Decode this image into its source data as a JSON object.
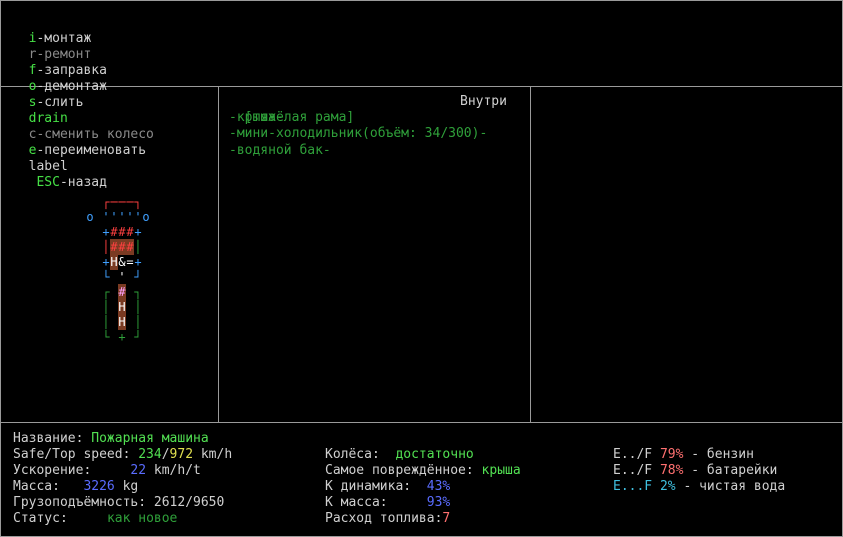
{
  "hotkeys": [
    {
      "key": "i",
      "label": "-монтаж",
      "enabled": true
    },
    {
      "key": "r",
      "label": "-ремонт",
      "enabled": false
    },
    {
      "key": "f",
      "label": "-заправка",
      "enabled": true
    },
    {
      "key": "o",
      "label": "-демонтаж",
      "enabled": true
    },
    {
      "key": "s",
      "label": "-слить",
      "enabled": true
    },
    {
      "key": "drain",
      "label": "",
      "enabled": true
    },
    {
      "key": "c",
      "label": "-сменить колесо",
      "enabled": false
    },
    {
      "key": "e",
      "label": "-переименовать",
      "enabled": true
    },
    {
      "key": "label",
      "label": "",
      "enabled": true
    },
    {
      "key": "ESC",
      "label": "-назад",
      "enabled": true
    }
  ],
  "parts": {
    "header_left": "[тяжёлая рама]",
    "header_right": "Внутри",
    "items": [
      "-крыша-",
      "-мини-холодильник(объём: 34/300)-",
      "-водяной бак-"
    ]
  },
  "vehicle_glyphs": [
    {
      "ch": "┌",
      "col": 2,
      "row": 0,
      "color": "#ff4040"
    },
    {
      "ch": "─",
      "col": 3,
      "row": 0,
      "color": "#ff4040"
    },
    {
      "ch": "─",
      "col": 4,
      "row": 0,
      "color": "#ff4040"
    },
    {
      "ch": "─",
      "col": 5,
      "row": 0,
      "color": "#ff4040"
    },
    {
      "ch": "┐",
      "col": 6,
      "row": 0,
      "color": "#ff4040"
    },
    {
      "ch": "o",
      "col": 0,
      "row": 1,
      "color": "#40a0ff"
    },
    {
      "ch": "'",
      "col": 2,
      "row": 1,
      "color": "#40a0ff"
    },
    {
      "ch": "'",
      "col": 3,
      "row": 1,
      "color": "#40a0ff"
    },
    {
      "ch": "'",
      "col": 4,
      "row": 1,
      "color": "#40a0ff"
    },
    {
      "ch": "'",
      "col": 5,
      "row": 1,
      "color": "#40a0ff"
    },
    {
      "ch": "'",
      "col": 6,
      "row": 1,
      "color": "#40a0ff"
    },
    {
      "ch": "o",
      "col": 7,
      "row": 1,
      "color": "#40a0ff"
    },
    {
      "ch": "+",
      "col": 2,
      "row": 2,
      "color": "#40a0ff"
    },
    {
      "ch": "#",
      "col": 3,
      "row": 2,
      "color": "#ff4040"
    },
    {
      "ch": "#",
      "col": 4,
      "row": 2,
      "color": "#ff4040"
    },
    {
      "ch": "#",
      "col": 5,
      "row": 2,
      "color": "#ff4040"
    },
    {
      "ch": "+",
      "col": 6,
      "row": 2,
      "color": "#40a0ff"
    },
    {
      "ch": "│",
      "col": 2,
      "row": 3,
      "color": "#ff4040"
    },
    {
      "ch": "#",
      "col": 3,
      "row": 3,
      "color": "#ff4040"
    },
    {
      "ch": "#",
      "col": 4,
      "row": 3,
      "color": "#ff4040"
    },
    {
      "ch": "#",
      "col": 5,
      "row": 3,
      "color": "#ff4040"
    },
    {
      "ch": "│",
      "col": 6,
      "row": 3,
      "color": "#2fa03a"
    },
    {
      "ch": "+",
      "col": 2,
      "row": 4,
      "color": "#40a0ff"
    },
    {
      "ch": "H",
      "col": 3,
      "row": 4,
      "color": "#ffffff"
    },
    {
      "ch": "&",
      "col": 4,
      "row": 4,
      "color": "#ffffff"
    },
    {
      "ch": "=",
      "col": 5,
      "row": 4,
      "color": "#ffffff"
    },
    {
      "ch": "+",
      "col": 6,
      "row": 4,
      "color": "#40a0ff"
    },
    {
      "ch": "└",
      "col": 2,
      "row": 5,
      "color": "#40a0ff"
    },
    {
      "ch": "'",
      "col": 4,
      "row": 5,
      "color": "#ffffff"
    },
    {
      "ch": "┘",
      "col": 6,
      "row": 5,
      "color": "#40a0ff"
    },
    {
      "ch": "┌",
      "col": 2,
      "row": 6,
      "color": "#2fa03a"
    },
    {
      "ch": "#",
      "col": 4,
      "row": 6,
      "color": "#ffa0ff"
    },
    {
      "ch": "┐",
      "col": 6,
      "row": 6,
      "color": "#2fa03a"
    },
    {
      "ch": "│",
      "col": 2,
      "row": 7,
      "color": "#2fa03a"
    },
    {
      "ch": "H",
      "col": 4,
      "row": 7,
      "color": "#ffffff"
    },
    {
      "ch": "│",
      "col": 6,
      "row": 7,
      "color": "#2fa03a"
    },
    {
      "ch": "│",
      "col": 2,
      "row": 8,
      "color": "#2fa03a"
    },
    {
      "ch": "H",
      "col": 4,
      "row": 8,
      "color": "#ffffff"
    },
    {
      "ch": "│",
      "col": 6,
      "row": 8,
      "color": "#2fa03a"
    },
    {
      "ch": "└",
      "col": 2,
      "row": 9,
      "color": "#2fa03a"
    },
    {
      "ch": "+",
      "col": 4,
      "row": 9,
      "color": "#2fa03a"
    },
    {
      "ch": "┘",
      "col": 6,
      "row": 9,
      "color": "#2fa03a"
    }
  ],
  "status": {
    "name_label": "Название:",
    "name_value": "Пожарная машина",
    "speed_label": "Safe/Top speed:",
    "speed_safe": "234",
    "speed_sep": "/",
    "speed_top": "972",
    "speed_unit": "km/h",
    "accel_label": "Ускорение:",
    "accel_value": "22",
    "accel_unit": "km/h/t",
    "mass_label": "Масса:",
    "mass_value": "3226",
    "mass_unit": "kg",
    "cargo_label": "Грузоподъёмность:",
    "cargo_value": "2612/9650",
    "state_label": "Статус:",
    "state_value": "как новое",
    "wheels_label": "Колёса:",
    "wheels_value": "достаточно",
    "damaged_label": "Самое повреждённое:",
    "damaged_value": "крыша",
    "kdyn_label": "К динамика:",
    "kdyn_value": "43%",
    "kmass_label": "К масса:",
    "kmass_value": "93%",
    "fuel_label": "Расход топлива:",
    "fuel_value": "7",
    "tanks": [
      {
        "gauge": "E../F",
        "percent": "79%",
        "name": "- бензин",
        "color": "#e0e0e0",
        "pct_color": "#ff7070"
      },
      {
        "gauge": "E../F",
        "percent": "78%",
        "name": "- батарейки",
        "color": "#e0e0e0",
        "pct_color": "#ff7070"
      },
      {
        "gauge": "E...F",
        "percent": "2%",
        "name": "- чистая вода",
        "color": "#40c0e0",
        "pct_color": "#40c0e0"
      }
    ]
  }
}
